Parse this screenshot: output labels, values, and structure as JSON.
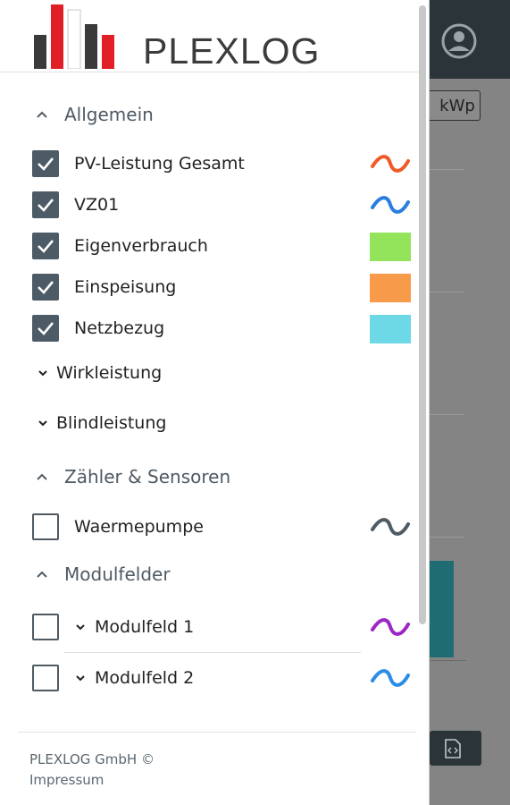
{
  "app": {
    "brand": "PLEXLOG"
  },
  "background": {
    "chip_label": "kWp"
  },
  "sections": {
    "allgemein": "Allgemein",
    "zaehler": "Zähler & Sensoren",
    "modulfelder": "Modulfelder"
  },
  "series": [
    {
      "label": "PV-Leistung Gesamt",
      "checked": true,
      "legend": "wave",
      "color": "#f05a28"
    },
    {
      "label": "VZ01",
      "checked": true,
      "legend": "wave",
      "color": "#2a7de1"
    },
    {
      "label": "Eigenverbrauch",
      "checked": true,
      "legend": "swatch",
      "color": "#93e45a"
    },
    {
      "label": "Einspeisung",
      "checked": true,
      "legend": "swatch",
      "color": "#f79a4a"
    },
    {
      "label": "Netzbezug",
      "checked": true,
      "legend": "swatch",
      "color": "#6dd8e6"
    }
  ],
  "subgroups": {
    "wirkleistung": "Wirkleistung",
    "blindleistung": "Blindleistung"
  },
  "sensors": [
    {
      "label": "Waermepumpe",
      "checked": false,
      "legend": "wave",
      "color": "#4e5c66"
    }
  ],
  "modulfelder": [
    {
      "label": "Modulfeld 1",
      "checked": false,
      "legend": "wave",
      "color": "#9b27c4"
    },
    {
      "label": "Modulfeld 2",
      "checked": false,
      "legend": "wave",
      "color": "#2a8de8"
    }
  ],
  "footer": {
    "company": "PLEXLOG GmbH ©",
    "impressum": "Impressum"
  }
}
